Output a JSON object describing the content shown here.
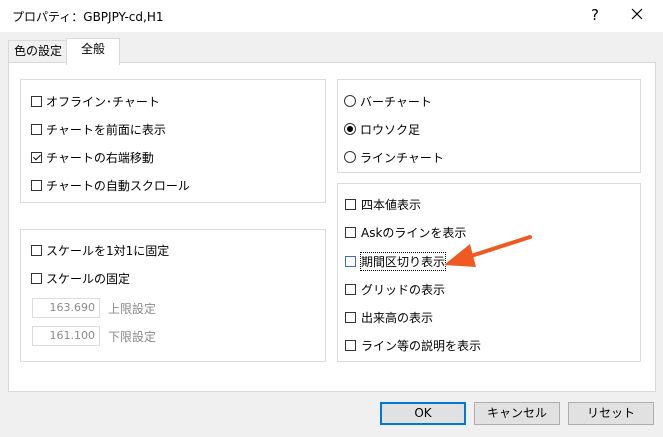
{
  "window": {
    "title": "プロパティ：GBPJPY-cd,H1",
    "help_glyph": "?",
    "close_icon": "close-icon"
  },
  "tabs": [
    {
      "label": "色の設定",
      "active": false
    },
    {
      "label": "全般",
      "active": true
    }
  ],
  "chart_options": [
    {
      "label": "オフライン･チャート",
      "checked": false
    },
    {
      "label": "チャートを前面に表示",
      "checked": false
    },
    {
      "label": "チャートの右端移動",
      "checked": true
    },
    {
      "label": "チャートの自動スクロール",
      "checked": false
    }
  ],
  "chart_type": [
    {
      "label": "バーチャート",
      "selected": false
    },
    {
      "label": "ロウソク足",
      "selected": true
    },
    {
      "label": "ラインチャート",
      "selected": false
    }
  ],
  "scale": {
    "fix_1to1": {
      "label": "スケールを1対1に固定",
      "checked": false
    },
    "fix": {
      "label": "スケールの固定",
      "checked": false
    },
    "upper_value": "163.690",
    "upper_label": "上限設定",
    "lower_value": "161.100",
    "lower_label": "下限設定"
  },
  "display_options": [
    {
      "label": "四本値表示",
      "checked": false
    },
    {
      "label": "Askのラインを表示",
      "checked": false
    },
    {
      "label": "期間区切り表示",
      "checked": false,
      "focused": true
    },
    {
      "label": "グリッドの表示",
      "checked": false
    },
    {
      "label": "出来高の表示",
      "checked": false
    },
    {
      "label": "ライン等の説明を表示",
      "checked": false
    }
  ],
  "annotation": {
    "arrow_color": "#f05a22"
  },
  "buttons": {
    "ok": "OK",
    "cancel": "キャンセル",
    "reset": "リセット"
  }
}
